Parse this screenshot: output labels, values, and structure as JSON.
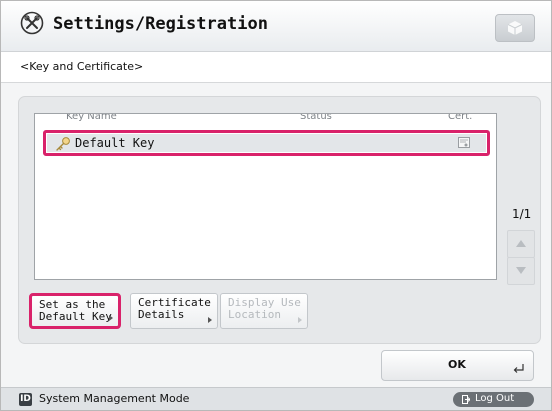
{
  "header": {
    "title": "Settings/Registration"
  },
  "breadcrumb": "<Key and Certificate>",
  "key_list": {
    "columns": [
      "Key Name",
      "Status",
      "Cert."
    ],
    "rows": [
      {
        "name": "Default Key",
        "status": "",
        "cert_icon": "certificate-icon"
      }
    ]
  },
  "pagination": {
    "page": "1/1"
  },
  "actions": {
    "set_default": "Set as the\nDefault Key",
    "certificate_details": "Certificate\nDetails",
    "display_use_location": "Display Use\nLocation"
  },
  "ok_label": "OK",
  "status_bar": {
    "mode_badge": "ID",
    "mode": "System Management Mode",
    "logout": "Log Out"
  },
  "colors": {
    "highlight": "#d9226a",
    "accent_dark": "#3a3f44"
  }
}
